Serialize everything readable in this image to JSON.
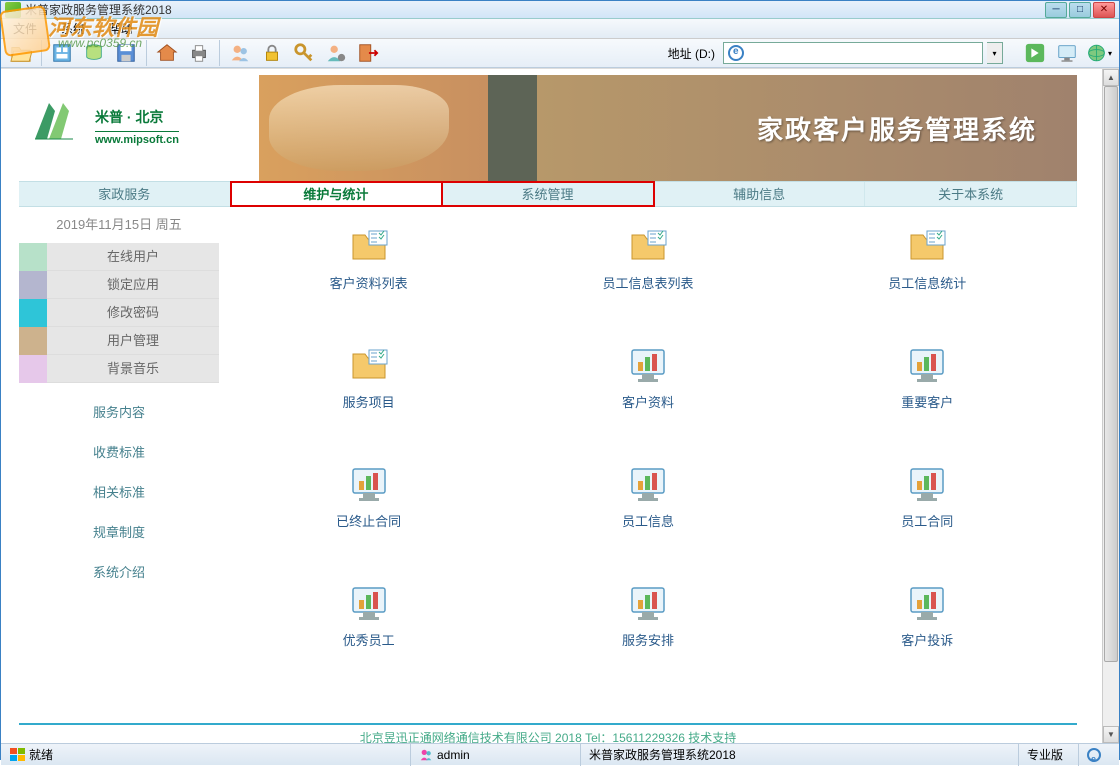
{
  "window": {
    "title": "米普家政服务管理系统2018"
  },
  "menubar": {
    "items": [
      "文件",
      "系统",
      "帮助"
    ]
  },
  "watermark": {
    "text": "河东软件园",
    "url": "www.pc0359.cn"
  },
  "toolbar": {
    "address_label": "地址 (D:)"
  },
  "logo": {
    "title": "米普 · 北京",
    "url": "www.mipsoft.cn"
  },
  "banner": {
    "title": "家政客户服务管理系统"
  },
  "nav_tabs": [
    {
      "label": "家政服务",
      "active": false,
      "highlight": false
    },
    {
      "label": "维护与统计",
      "active": true,
      "highlight": true
    },
    {
      "label": "系统管理",
      "active": false,
      "highlight": true
    },
    {
      "label": "辅助信息",
      "active": false,
      "highlight": false
    },
    {
      "label": "关于本系统",
      "active": false,
      "highlight": false
    }
  ],
  "date_text": "2019年11月15日  周五",
  "side_items": [
    {
      "label": "在线用户",
      "stripe": "#b7e1c9"
    },
    {
      "label": "锁定应用",
      "stripe": "#b4b6cf"
    },
    {
      "label": "修改密码",
      "stripe": "#2ec5d8"
    },
    {
      "label": "用户管理",
      "stripe": "#cdb28d"
    },
    {
      "label": "背景音乐",
      "stripe": "#e6c8ea"
    }
  ],
  "side_links": [
    "服务内容",
    "收费标准",
    "相关标准",
    "规章制度",
    "系统介绍"
  ],
  "grid_rows": [
    [
      {
        "label": "客户资料列表",
        "icon": "folder-list"
      },
      {
        "label": "员工信息表列表",
        "icon": "folder-list"
      },
      {
        "label": "员工信息统计",
        "icon": "folder-list"
      }
    ],
    [
      {
        "label": "服务项目",
        "icon": "folder-list"
      },
      {
        "label": "客户资料",
        "icon": "monitor-chart"
      },
      {
        "label": "重要客户",
        "icon": "monitor-chart"
      }
    ],
    [
      {
        "label": "已终止合同",
        "icon": "monitor-chart"
      },
      {
        "label": "员工信息",
        "icon": "monitor-chart"
      },
      {
        "label": "员工合同",
        "icon": "monitor-chart"
      }
    ],
    [
      {
        "label": "优秀员工",
        "icon": "monitor-chart"
      },
      {
        "label": "服务安排",
        "icon": "monitor-chart"
      },
      {
        "label": "客户投诉",
        "icon": "monitor-chart"
      }
    ]
  ],
  "page_footer": "北京昱迅正通网络通信技术有限公司  2018     Tel：15611229326     技术支持",
  "status": {
    "ready": "就绪",
    "user": "admin",
    "app": "米普家政服务管理系统2018",
    "edition": "专业版"
  }
}
